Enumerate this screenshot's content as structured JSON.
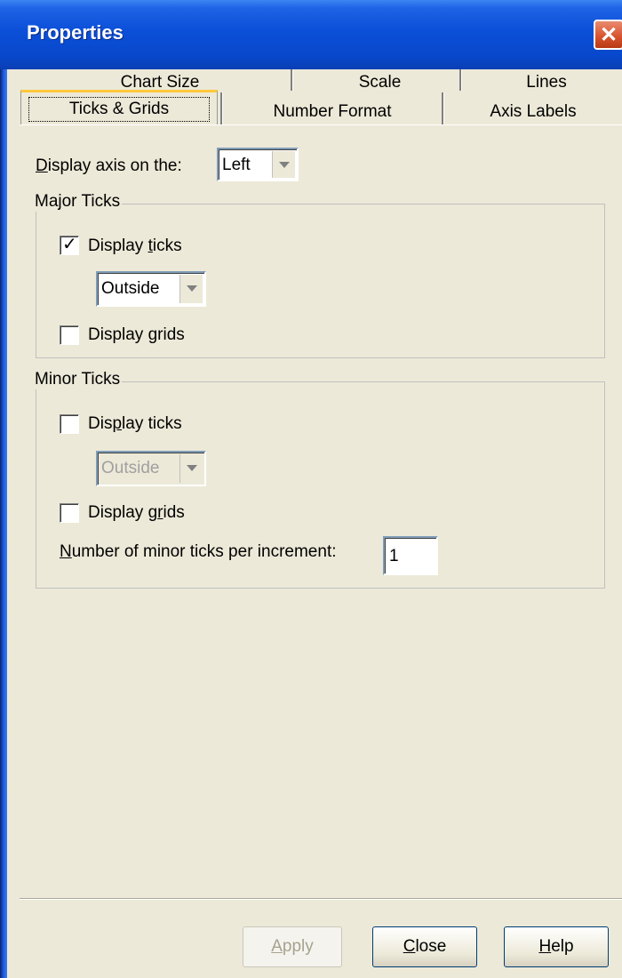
{
  "window": {
    "title": "Properties",
    "close_glyph": "✕",
    "accent": "#0b4fd8",
    "close_color": "#d6512b"
  },
  "tabs": {
    "back_row": [
      "Chart Size",
      "Scale",
      "Lines"
    ],
    "front_row": [
      "Ticks & Grids",
      "Number Format",
      "Axis Labels"
    ],
    "active": "Ticks & Grids"
  },
  "display_axis": {
    "label_mnemonic": "D",
    "label_rest": "isplay axis on the:",
    "value": "Left"
  },
  "major_ticks": {
    "legend": "Major Ticks",
    "display_ticks": {
      "pre": "Display ",
      "mnemonic": "t",
      "post": "icks",
      "checked": true,
      "check_glyph": "✓"
    },
    "position": "Outside",
    "display_grids": {
      "pre": "Display ",
      "mnemonic": "g",
      "post": "rids",
      "checked": false
    }
  },
  "minor_ticks": {
    "legend": "Minor Ticks",
    "display_ticks": {
      "pre": "Dis",
      "mnemonic": "p",
      "post": "lay ticks",
      "checked": false
    },
    "position": "Outside",
    "position_enabled": false,
    "display_grids": {
      "pre": "Display g",
      "mnemonic": "r",
      "post": "ids",
      "checked": false
    },
    "per_increment": {
      "mnemonic": "N",
      "rest": "umber of minor ticks per increment:",
      "value": "1"
    }
  },
  "buttons": {
    "apply": {
      "mnemonic": "A",
      "rest": "pply",
      "enabled": false
    },
    "close": {
      "mnemonic": "C",
      "rest": "lose"
    },
    "help": {
      "mnemonic": "H",
      "rest": "elp"
    }
  }
}
